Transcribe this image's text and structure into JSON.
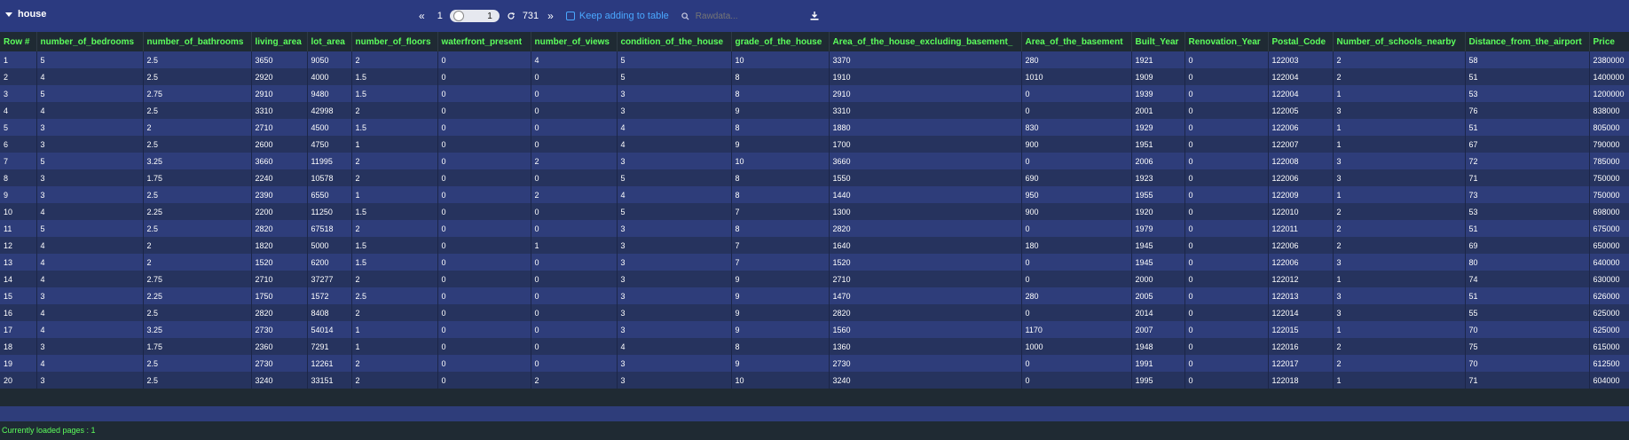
{
  "title": "house",
  "pager": {
    "prev": "«",
    "current": "1",
    "input_value": "1",
    "total": "731",
    "next": "»",
    "keep_label": "Keep adding to table",
    "search_placeholder": "Rawdata..."
  },
  "columns": [
    "Row #",
    "number_of_bedrooms",
    "number_of_bathrooms",
    "living_area",
    "lot_area",
    "number_of_floors",
    "waterfront_present",
    "number_of_views",
    "condition_of_the_house",
    "grade_of_the_house",
    "Area_of_the_house_excluding_basement_",
    "Area_of_the_basement",
    "Built_Year",
    "Renovation_Year",
    "Postal_Code",
    "Number_of_schools_nearby",
    "Distance_from_the_airport",
    "Price"
  ],
  "rows": [
    [
      "1",
      "5",
      "2.5",
      "3650",
      "9050",
      "2",
      "0",
      "4",
      "5",
      "10",
      "3370",
      "280",
      "1921",
      "0",
      "122003",
      "2",
      "58",
      "2380000"
    ],
    [
      "2",
      "4",
      "2.5",
      "2920",
      "4000",
      "1.5",
      "0",
      "0",
      "5",
      "8",
      "1910",
      "1010",
      "1909",
      "0",
      "122004",
      "2",
      "51",
      "1400000"
    ],
    [
      "3",
      "5",
      "2.75",
      "2910",
      "9480",
      "1.5",
      "0",
      "0",
      "3",
      "8",
      "2910",
      "0",
      "1939",
      "0",
      "122004",
      "1",
      "53",
      "1200000"
    ],
    [
      "4",
      "4",
      "2.5",
      "3310",
      "42998",
      "2",
      "0",
      "0",
      "3",
      "9",
      "3310",
      "0",
      "2001",
      "0",
      "122005",
      "3",
      "76",
      "838000"
    ],
    [
      "5",
      "3",
      "2",
      "2710",
      "4500",
      "1.5",
      "0",
      "0",
      "4",
      "8",
      "1880",
      "830",
      "1929",
      "0",
      "122006",
      "1",
      "51",
      "805000"
    ],
    [
      "6",
      "3",
      "2.5",
      "2600",
      "4750",
      "1",
      "0",
      "0",
      "4",
      "9",
      "1700",
      "900",
      "1951",
      "0",
      "122007",
      "1",
      "67",
      "790000"
    ],
    [
      "7",
      "5",
      "3.25",
      "3660",
      "11995",
      "2",
      "0",
      "2",
      "3",
      "10",
      "3660",
      "0",
      "2006",
      "0",
      "122008",
      "3",
      "72",
      "785000"
    ],
    [
      "8",
      "3",
      "1.75",
      "2240",
      "10578",
      "2",
      "0",
      "0",
      "5",
      "8",
      "1550",
      "690",
      "1923",
      "0",
      "122006",
      "3",
      "71",
      "750000"
    ],
    [
      "9",
      "3",
      "2.5",
      "2390",
      "6550",
      "1",
      "0",
      "2",
      "4",
      "8",
      "1440",
      "950",
      "1955",
      "0",
      "122009",
      "1",
      "73",
      "750000"
    ],
    [
      "10",
      "4",
      "2.25",
      "2200",
      "11250",
      "1.5",
      "0",
      "0",
      "5",
      "7",
      "1300",
      "900",
      "1920",
      "0",
      "122010",
      "2",
      "53",
      "698000"
    ],
    [
      "11",
      "5",
      "2.5",
      "2820",
      "67518",
      "2",
      "0",
      "0",
      "3",
      "8",
      "2820",
      "0",
      "1979",
      "0",
      "122011",
      "2",
      "51",
      "675000"
    ],
    [
      "12",
      "4",
      "2",
      "1820",
      "5000",
      "1.5",
      "0",
      "1",
      "3",
      "7",
      "1640",
      "180",
      "1945",
      "0",
      "122006",
      "2",
      "69",
      "650000"
    ],
    [
      "13",
      "4",
      "2",
      "1520",
      "6200",
      "1.5",
      "0",
      "0",
      "3",
      "7",
      "1520",
      "0",
      "1945",
      "0",
      "122006",
      "3",
      "80",
      "640000"
    ],
    [
      "14",
      "4",
      "2.75",
      "2710",
      "37277",
      "2",
      "0",
      "0",
      "3",
      "9",
      "2710",
      "0",
      "2000",
      "0",
      "122012",
      "1",
      "74",
      "630000"
    ],
    [
      "15",
      "3",
      "2.25",
      "1750",
      "1572",
      "2.5",
      "0",
      "0",
      "3",
      "9",
      "1470",
      "280",
      "2005",
      "0",
      "122013",
      "3",
      "51",
      "626000"
    ],
    [
      "16",
      "4",
      "2.5",
      "2820",
      "8408",
      "2",
      "0",
      "0",
      "3",
      "9",
      "2820",
      "0",
      "2014",
      "0",
      "122014",
      "3",
      "55",
      "625000"
    ],
    [
      "17",
      "4",
      "3.25",
      "2730",
      "54014",
      "1",
      "0",
      "0",
      "3",
      "9",
      "1560",
      "1170",
      "2007",
      "0",
      "122015",
      "1",
      "70",
      "625000"
    ],
    [
      "18",
      "3",
      "1.75",
      "2360",
      "7291",
      "1",
      "0",
      "0",
      "4",
      "8",
      "1360",
      "1000",
      "1948",
      "0",
      "122016",
      "2",
      "75",
      "615000"
    ],
    [
      "19",
      "4",
      "2.5",
      "2730",
      "12261",
      "2",
      "0",
      "0",
      "3",
      "9",
      "2730",
      "0",
      "1991",
      "0",
      "122017",
      "2",
      "70",
      "612500"
    ],
    [
      "20",
      "3",
      "2.5",
      "3240",
      "33151",
      "2",
      "0",
      "2",
      "3",
      "10",
      "3240",
      "0",
      "1995",
      "0",
      "122018",
      "1",
      "71",
      "604000"
    ]
  ],
  "footer": "Currently loaded pages : 1",
  "colors": {
    "header_bar": "#2b3a80",
    "header_text": "#5cff5c",
    "row_odd": "#2e3d7a",
    "row_even": "#26335e",
    "accent": "#4aa8ff"
  }
}
